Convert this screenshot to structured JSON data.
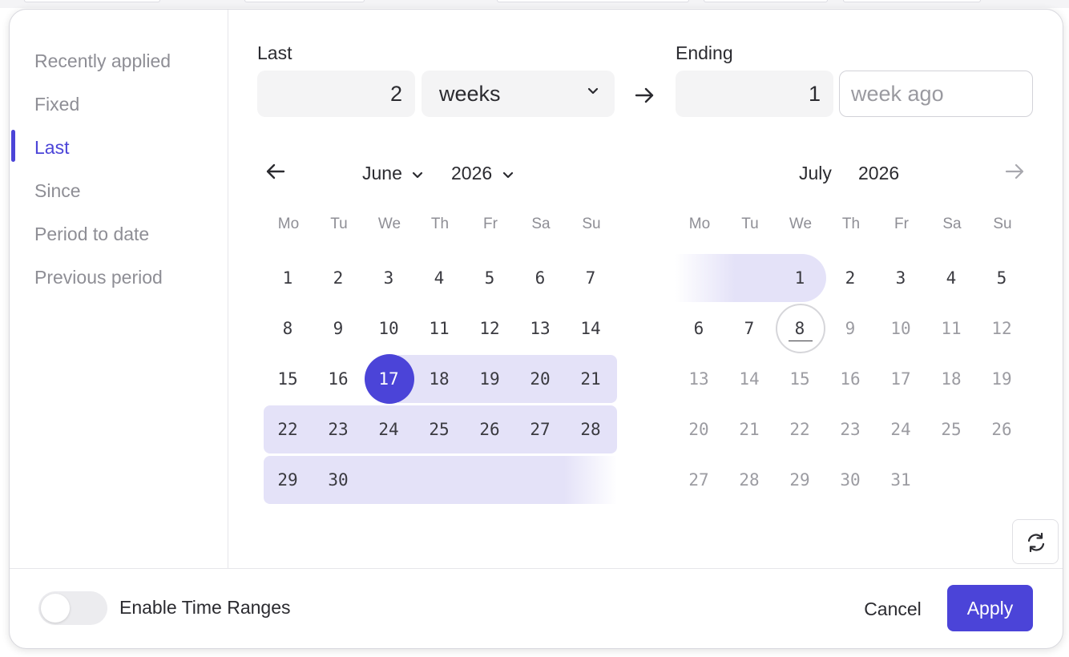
{
  "sidebar": {
    "items": [
      {
        "label": "Recently applied"
      },
      {
        "label": "Fixed"
      },
      {
        "label": "Last"
      },
      {
        "label": "Since"
      },
      {
        "label": "Period to date"
      },
      {
        "label": "Previous period"
      }
    ],
    "active_index": 2
  },
  "range": {
    "last_label": "Last",
    "last_value": "2",
    "unit_selected": "weeks",
    "ending_label": "Ending",
    "ending_value": "1",
    "ending_placeholder": "week ago"
  },
  "calendar": {
    "weekdays": [
      "Mo",
      "Tu",
      "We",
      "Th",
      "Fr",
      "Sa",
      "Su"
    ],
    "left": {
      "month": "June",
      "year": "2026",
      "days": [
        "1",
        "2",
        "3",
        "4",
        "5",
        "6",
        "7",
        "8",
        "9",
        "10",
        "11",
        "12",
        "13",
        "14",
        "15",
        "16",
        "17",
        "18",
        "19",
        "20",
        "21",
        "22",
        "23",
        "24",
        "25",
        "26",
        "27",
        "28",
        "29",
        "30"
      ],
      "selected_start": "17"
    },
    "right": {
      "month": "July",
      "year": "2026",
      "days": [
        "1",
        "2",
        "3",
        "4",
        "5",
        "6",
        "7",
        "8",
        "9",
        "10",
        "11",
        "12",
        "13",
        "14",
        "15",
        "16",
        "17",
        "18",
        "19",
        "20",
        "21",
        "22",
        "23",
        "24",
        "25",
        "26",
        "27",
        "28",
        "29",
        "30",
        "31"
      ],
      "range_end": "1",
      "today": "8"
    }
  },
  "footer": {
    "toggle_label": "Enable Time Ranges",
    "cancel_label": "Cancel",
    "apply_label": "Apply"
  },
  "colors": {
    "accent": "#4b44d8",
    "range_fill": "#e4e2f8"
  },
  "icons": [
    "chevron-down-icon",
    "arrow-right-icon",
    "arrow-left-icon",
    "refresh-icon"
  ]
}
